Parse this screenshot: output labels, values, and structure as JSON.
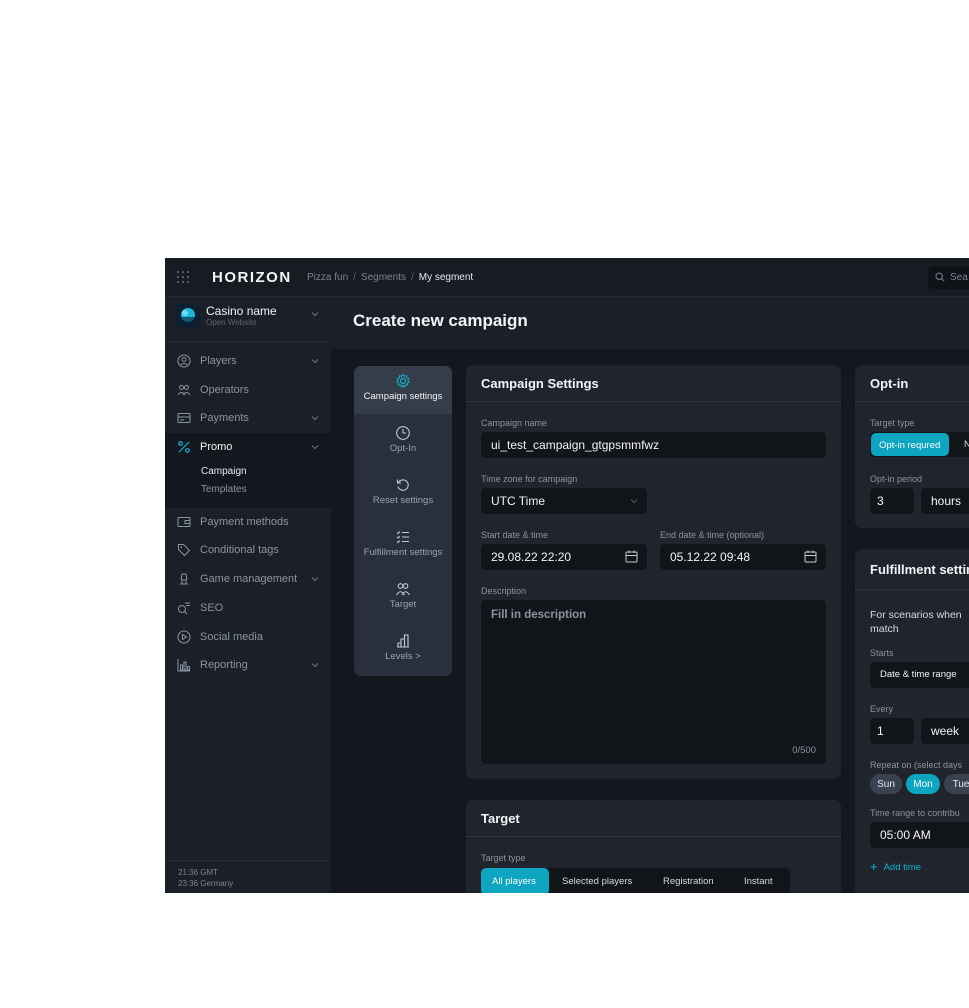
{
  "topbar": {
    "logo": "HORIZON",
    "breadcrumb": [
      "Pizza fun",
      "Segments",
      "My segment"
    ],
    "search_placeholder": "Sea"
  },
  "sidebar": {
    "casino_name": "Casino name",
    "casino_sub": "Open Website",
    "items": [
      {
        "label": "Players",
        "icon": "user-circle-icon",
        "chevron": true
      },
      {
        "label": "Operators",
        "icon": "users-icon",
        "chevron": false
      },
      {
        "label": "Payments",
        "icon": "payments-icon",
        "chevron": true
      },
      {
        "label": "Promo",
        "icon": "percent-icon",
        "chevron": true,
        "active": true
      },
      {
        "label": "Payment methods",
        "icon": "wallet-icon",
        "chevron": false
      },
      {
        "label": "Conditional tags",
        "icon": "tag-icon",
        "chevron": false
      },
      {
        "label": "Game management",
        "icon": "game-icon",
        "chevron": true
      },
      {
        "label": "SEO",
        "icon": "seo-icon",
        "chevron": false
      },
      {
        "label": "Social media",
        "icon": "play-circle-icon",
        "chevron": false
      },
      {
        "label": "Reporting",
        "icon": "chart-icon",
        "chevron": true
      }
    ],
    "promo_sub": [
      "Campaign",
      "Templates"
    ],
    "clock": [
      "21:36 GMT",
      "23:36 Germany"
    ]
  },
  "header": {
    "title": "Create new campaign"
  },
  "steps": [
    {
      "label": "Campaign settings",
      "icon": "gear-icon",
      "active": true
    },
    {
      "label": "Opt-In",
      "icon": "clock-icon"
    },
    {
      "label": "Reset settings",
      "icon": "reset-icon"
    },
    {
      "label": "Fulfillment settings",
      "icon": "checklist-icon"
    },
    {
      "label": "Target",
      "icon": "users-icon"
    },
    {
      "label": "Levels >",
      "icon": "levels-icon"
    }
  ],
  "campaign_settings": {
    "title": "Campaign Settings",
    "name_label": "Campaign name",
    "name_value": "ui_test_campaign_gtgpsmmfwz",
    "tz_label": "Time zone for campaign",
    "tz_value": "UTC Time",
    "start_label": "Start date & time",
    "start_value": "29.08.22  22:20",
    "end_label": "End date & time (optional)",
    "end_value": "05.12.22  09:48",
    "desc_label": "Description",
    "desc_placeholder": "Fill in description",
    "desc_count": "0/500"
  },
  "target": {
    "title": "Target",
    "type_label": "Target type",
    "options": [
      "All players",
      "Selected players",
      "Registration",
      "Instant"
    ],
    "selected": "All players"
  },
  "optin": {
    "title": "Opt-in",
    "type_label": "Target type",
    "type_selected": "Opt-in requred",
    "type_other": "N",
    "period_label": "Opt-in period",
    "period_value": "3",
    "period_unit": "hours"
  },
  "fulfillment": {
    "title": "Fulfillment settin",
    "desc_line1": "For scenarios when",
    "desc_line2": "match",
    "starts_label": "Starts",
    "starts_value": "Date & time range",
    "every_label": "Every",
    "every_value": "1",
    "every_unit": "week",
    "repeat_label": "Repeat on (select days",
    "days": [
      "Sun",
      "Mon",
      "Tue"
    ],
    "selected_day": "Mon",
    "range_label": "Time range to contribu",
    "range_value": "05:00 AM",
    "add_time": "Add time"
  },
  "colors": {
    "accent": "#0ea5c0",
    "bg": "#14171d",
    "card": "#1f242d"
  }
}
